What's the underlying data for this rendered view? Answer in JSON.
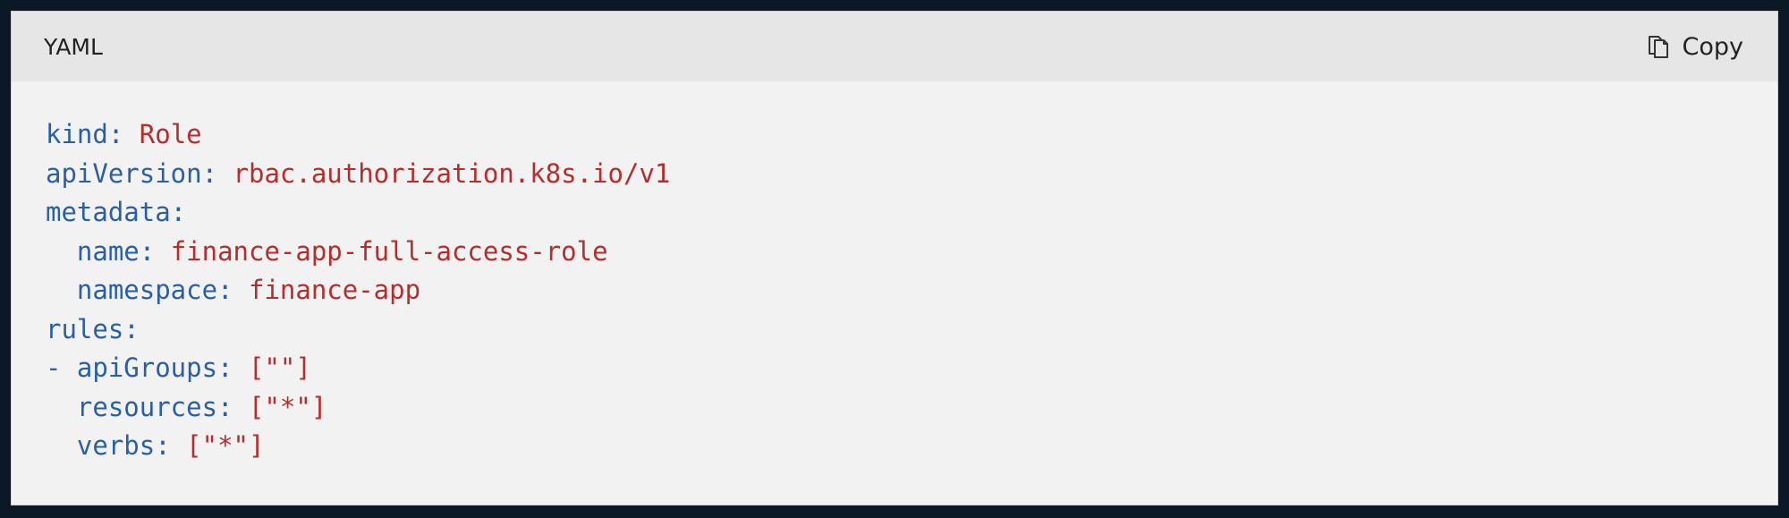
{
  "code_block": {
    "language_label": "YAML",
    "copy_label": "Copy",
    "copy_icon": "copy-icon",
    "colors": {
      "key": "#2b5fa5",
      "value": "#b52e2e",
      "header_bg": "#e6e6e6",
      "body_bg": "#f2f2f2"
    },
    "lines": [
      {
        "key": "kind:",
        "value": "Role"
      },
      {
        "key": "apiVersion:",
        "value": "rbac.authorization.k8s.io/v1"
      },
      {
        "key": "metadata:",
        "value": ""
      },
      {
        "key": "  name:",
        "value": "finance-app-full-access-role"
      },
      {
        "key": "  namespace:",
        "value": "finance-app"
      },
      {
        "key": "rules:",
        "value": ""
      },
      {
        "key": "- apiGroups:",
        "value": "[\"\"]"
      },
      {
        "key": "  resources:",
        "value": "[\"*\"]"
      },
      {
        "key": "  verbs:",
        "value": "[\"*\"]"
      }
    ]
  }
}
